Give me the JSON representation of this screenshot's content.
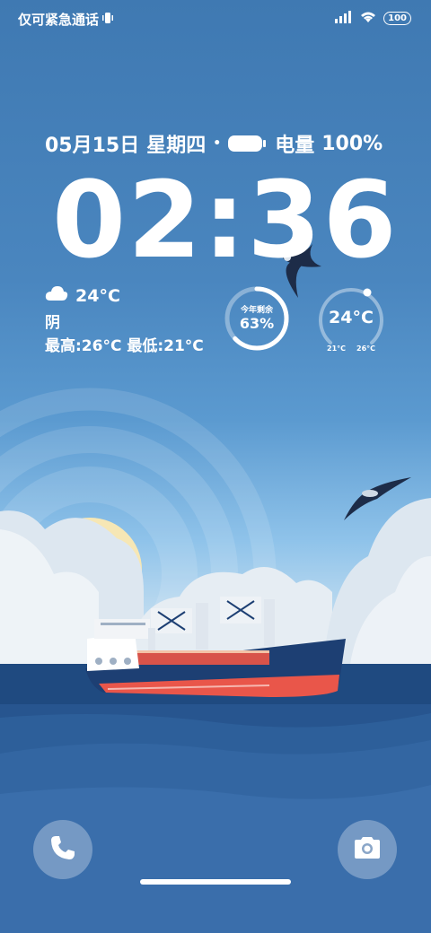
{
  "status_bar": {
    "carrier_text": "仅可紧急通话",
    "battery_level": "100"
  },
  "lockscreen": {
    "date": "05月15日",
    "weekday": "星期四",
    "separator": "•",
    "battery_label": "电量",
    "battery_percent": "100%",
    "time": "02:36"
  },
  "weather": {
    "temperature": "24°C",
    "condition": "阴",
    "range": "最高:26°C 最低:21°C"
  },
  "widgets": {
    "year_progress": {
      "label": "今年剩余",
      "value": "63%",
      "fraction": 0.63
    },
    "temperature": {
      "value": "24°C",
      "low": "21°C",
      "high": "26°C"
    }
  },
  "colors": {
    "sky_top": "#3f79b2",
    "sea": "#27558f",
    "ship_hull": "#1d3f73",
    "ship_stripe": "#e9564a"
  },
  "icons": {
    "status_vibrate": "vibrate-icon",
    "status_signal": "signal-icon",
    "status_wifi": "wifi-icon",
    "weather": "cloud-icon",
    "left_shortcut": "phone-icon",
    "right_shortcut": "camera-icon"
  }
}
